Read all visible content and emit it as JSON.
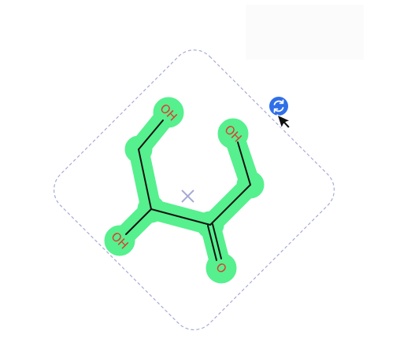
{
  "molecule": {
    "atoms": {
      "oh_top_left": "OH",
      "oh_top_right": "OH",
      "oh_bottom_left": "OH",
      "o_carbonyl": "O"
    }
  },
  "colors": {
    "selection_highlight": "#56f08e",
    "bond": "#111111",
    "heteroatom_label": "#e03a2e",
    "selection_box": "#a7aad6",
    "center_marker": "#a7aad6",
    "rotate_handle": "#2f6fe8"
  },
  "icons": {
    "rotate_handle": "rotate-icon",
    "cursor": "cursor-arrow-icon",
    "center": "center-cross-icon"
  }
}
